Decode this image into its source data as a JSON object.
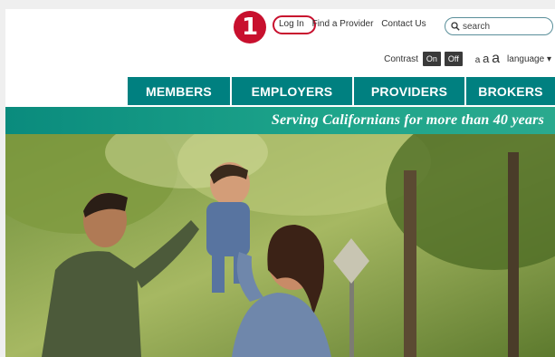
{
  "annotation": {
    "step_number": "1"
  },
  "header": {
    "links": [
      "Log In",
      "Find a Provider",
      "Contact Us"
    ],
    "search_placeholder": "search"
  },
  "accessibility": {
    "contrast_label": "Contrast",
    "on_label": "On",
    "off_label": "Off",
    "text_sizes": [
      "a",
      "a",
      "a"
    ],
    "language_label": "language"
  },
  "nav": {
    "items": [
      "MEMBERS",
      "EMPLOYERS",
      "PROVIDERS",
      "BROKERS"
    ]
  },
  "banner": {
    "text": "Serving Californians for more than 40 years"
  },
  "colors": {
    "accent": "#c8102e",
    "nav_bg": "#008080",
    "banner_bg": "#1ea58b"
  }
}
